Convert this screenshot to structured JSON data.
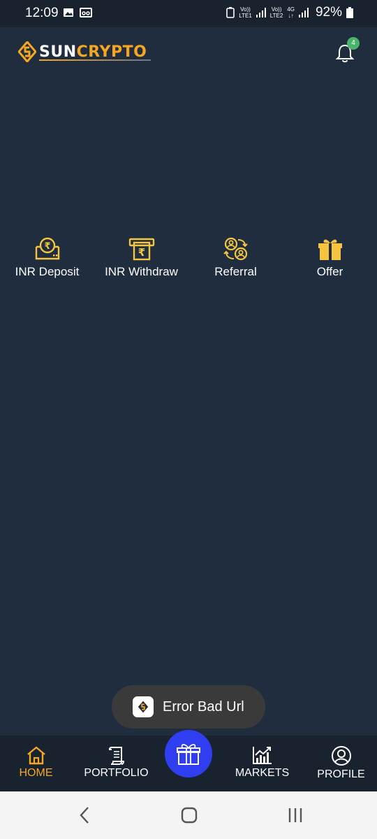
{
  "status_bar": {
    "time": "12:09",
    "lte1_top": "Vo))",
    "lte1_bottom": "LTE1",
    "lte2_top": "Vo))",
    "lte2_bottom": "LTE2",
    "net_top": "4G",
    "net_bottom": "↓↑",
    "battery": "92%"
  },
  "header": {
    "logo_sun": "SUN",
    "logo_crypto": "CRYPTO",
    "notification_count": "4"
  },
  "quick_actions": [
    {
      "label": "INR Deposit",
      "icon": "inr-deposit-icon"
    },
    {
      "label": "INR Withdraw",
      "icon": "inr-withdraw-icon"
    },
    {
      "label": "Referral",
      "icon": "referral-icon"
    },
    {
      "label": "Offer",
      "icon": "gift-icon"
    }
  ],
  "toast": {
    "text": "Error Bad Url"
  },
  "bottom_nav": {
    "home": "HOME",
    "portfolio": "PORTFOLIO",
    "markets": "MARKETS",
    "profile": "PROFILE",
    "active": "home"
  },
  "colors": {
    "background": "#1f2d3e",
    "accent": "#f5a623",
    "fab": "#2f3ef0",
    "badge": "#49b36b"
  }
}
